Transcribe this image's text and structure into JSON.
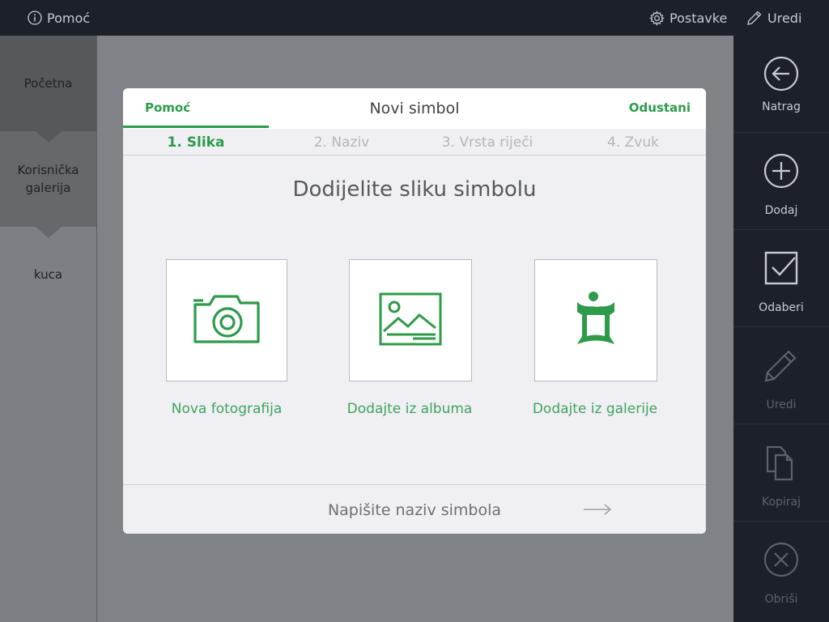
{
  "topbar": {
    "help_label": "Pomoć",
    "settings_label": "Postavke",
    "edit_label": "Uredi",
    "help_icon": "info-circle-icon",
    "settings_icon": "gear-icon",
    "edit_icon": "pencil-icon"
  },
  "sidebar": {
    "items": [
      {
        "label": "Početna"
      },
      {
        "label": "Korisnička galerija"
      },
      {
        "label": "kuca"
      }
    ]
  },
  "toolbar": {
    "items": [
      {
        "label": "Natrag",
        "icon": "back-arrow-circle-icon",
        "enabled": true
      },
      {
        "label": "Dodaj",
        "icon": "plus-circle-icon",
        "enabled": true
      },
      {
        "label": "Odaberi",
        "icon": "checkbox-icon",
        "enabled": true
      },
      {
        "label": "Uredi",
        "icon": "pencil-icon",
        "enabled": false
      },
      {
        "label": "Kopiraj",
        "icon": "copy-icon",
        "enabled": false
      },
      {
        "label": "Obriši",
        "icon": "close-circle-icon",
        "enabled": false
      }
    ]
  },
  "modal": {
    "help_label": "Pomoć",
    "title": "Novi simbol",
    "cancel_label": "Odustani",
    "steps": [
      {
        "label": "1. Slika",
        "active": true
      },
      {
        "label": "2. Naziv",
        "active": false
      },
      {
        "label": "3. Vrsta riječi",
        "active": false
      },
      {
        "label": "4. Zvuk",
        "active": false
      }
    ],
    "heading": "Dodijelite sliku simbolu",
    "options": [
      {
        "label": "Nova fotografija",
        "icon": "camera-icon"
      },
      {
        "label": "Dodajte iz albuma",
        "icon": "image-icon"
      },
      {
        "label": "Dodajte iz galerije",
        "icon": "gallery-symbol-icon"
      }
    ],
    "footer_label": "Napišite naziv simbola",
    "footer_icon": "arrow-right-icon"
  },
  "colors": {
    "accent": "#2e9b4a",
    "dark_bar": "#1c2029",
    "overlay": "#7f8287"
  }
}
